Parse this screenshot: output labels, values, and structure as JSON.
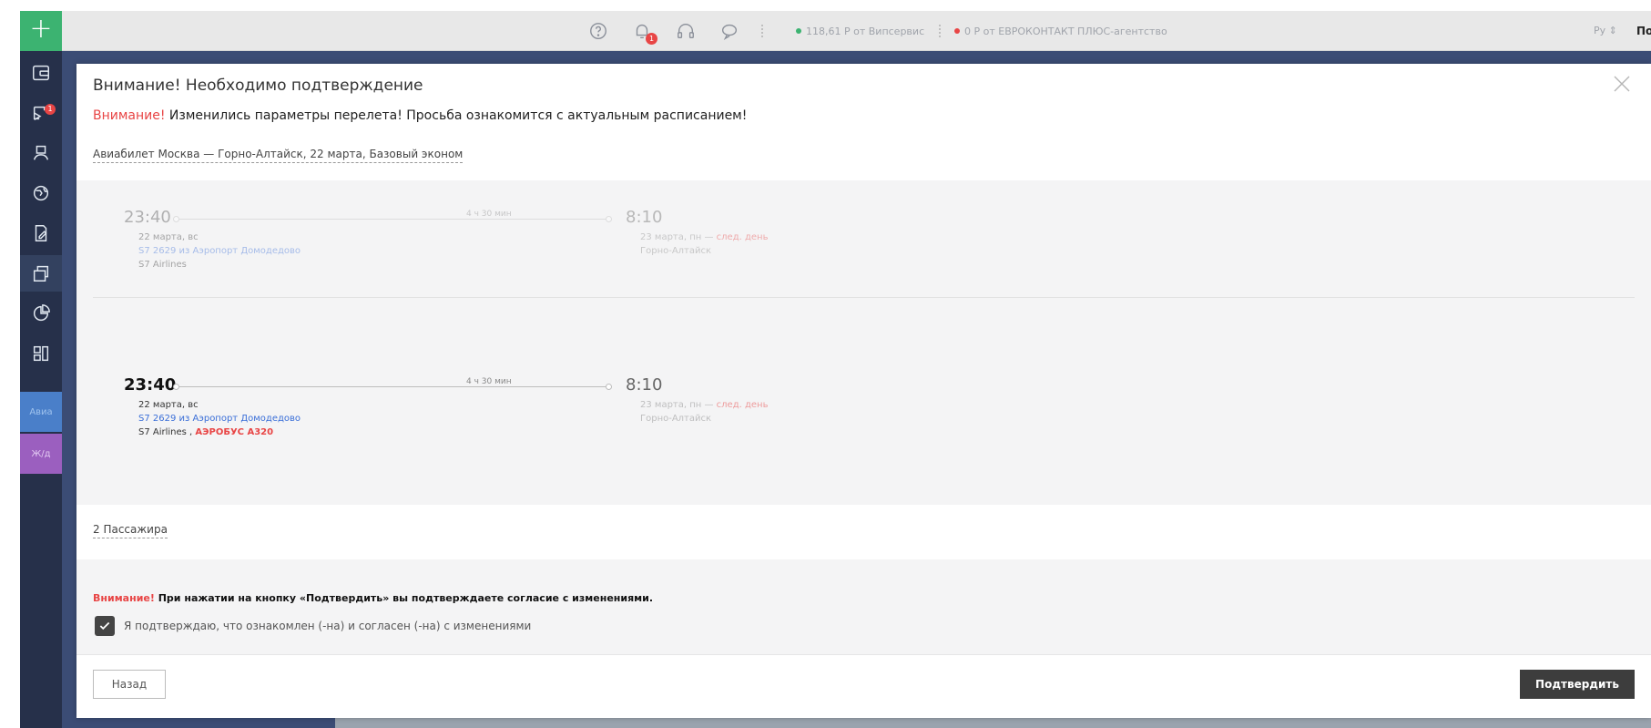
{
  "sidebar": {
    "add_label": "+",
    "badge_count": "1",
    "tag_avia": "Авиа",
    "tag_rail": "Ж/д"
  },
  "topbar": {
    "notif_count": "1",
    "balance1_amount": "118,61 Р от Випсервис",
    "balance2_amount": "0 Р от ЕВРОКОНТАКТ ПЛЮС-агентство",
    "lang": "Ру ⇕",
    "user": "Портбилет П"
  },
  "colors": {
    "accent_green": "#3cb371",
    "sidebar_bg": "#26304a",
    "warn_red": "#e84545",
    "confirm_btn": "#3d3d3d"
  },
  "modal": {
    "title": "Внимание! Необходимо подтверждение",
    "warn_prefix": "Внимание!",
    "warn_text": " Изменились параметры перелета! Просьба ознакомится с актуальным расписанием!",
    "route": "Авиабилет Москва — Горно-Алтайск, 22 марта, Базовый эконом",
    "segments": [
      {
        "dep_time": "23:40",
        "duration": "4 ч 30 мин",
        "arr_time": "8:10",
        "dep_date": "22 марта, вс",
        "flight": "S7 2629 из Аэропорт Домодедово",
        "airline": "S7 Airlines",
        "aircraft": "",
        "arr_date": "23 марта, пн — ",
        "next_day": "след. день",
        "arr_city": "Горно-Алтайск"
      },
      {
        "dep_time": "23:40",
        "duration": "4 ч 30 мин",
        "arr_time": "8:10",
        "dep_date": "22 марта, вс",
        "flight": "S7 2629 из Аэропорт Домодедово",
        "airline": "S7 Airlines , ",
        "aircraft": "АЭРОБУС А320",
        "arr_date": "23 марта, пн — ",
        "next_day": "след. день",
        "arr_city": "Горно-Алтайск"
      }
    ],
    "passengers": "2 Пассажира",
    "agree_prefix": "Внимание!",
    "agree_note": " При нажатии на кнопку «Подтвердить» вы подтверждаете согласие с изменениями.",
    "agree_label": "Я подтверждаю, что ознакомлен (-на) и согласен (-на) с изменениями",
    "agree_checked": true,
    "back_label": "Назад",
    "confirm_label": "Подтвердить"
  }
}
